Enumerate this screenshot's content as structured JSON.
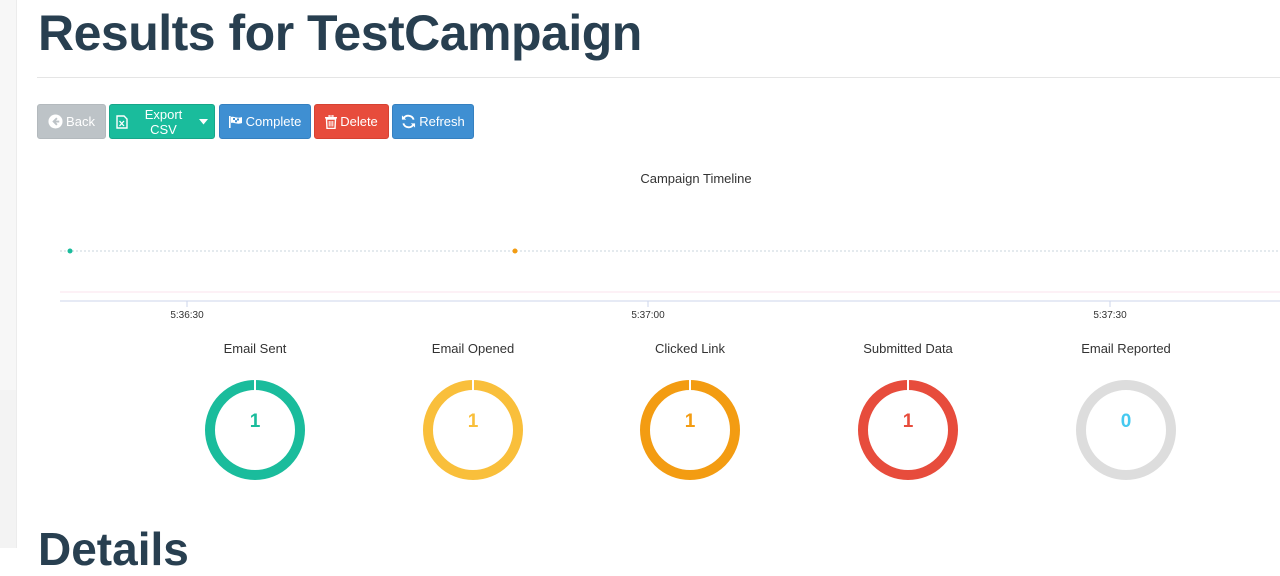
{
  "page": {
    "title": "Results for TestCampaign",
    "details_heading": "Details"
  },
  "toolbar": {
    "back_label": "Back",
    "export_label": "Export CSV",
    "complete_label": "Complete",
    "delete_label": "Delete",
    "refresh_label": "Refresh"
  },
  "timeline": {
    "title": "Campaign Timeline",
    "ticks": [
      "5:36:30",
      "5:37:00",
      "5:37:30"
    ],
    "events": [
      {
        "type": "Email Sent",
        "color": "#1abc9c"
      },
      {
        "type": "Email Opened",
        "color": "#f39c12"
      }
    ]
  },
  "stats": [
    {
      "label": "Email Sent",
      "value": "1",
      "color": "#1abc9c"
    },
    {
      "label": "Email Opened",
      "value": "1",
      "color": "#f9bf3b"
    },
    {
      "label": "Clicked Link",
      "value": "1",
      "color": "#f39c12"
    },
    {
      "label": "Submitted Data",
      "value": "1",
      "color": "#e74c3c"
    },
    {
      "label": "Email Reported",
      "value": "0",
      "color": "#dddddd",
      "number_color": "#45c9f0"
    }
  ],
  "colors": {
    "heading": "#283f50",
    "back": "#bdc3c7",
    "export": "#1abc9c",
    "complete": "#3f8fd2",
    "delete": "#e74c3c",
    "refresh": "#3f8fd2"
  }
}
